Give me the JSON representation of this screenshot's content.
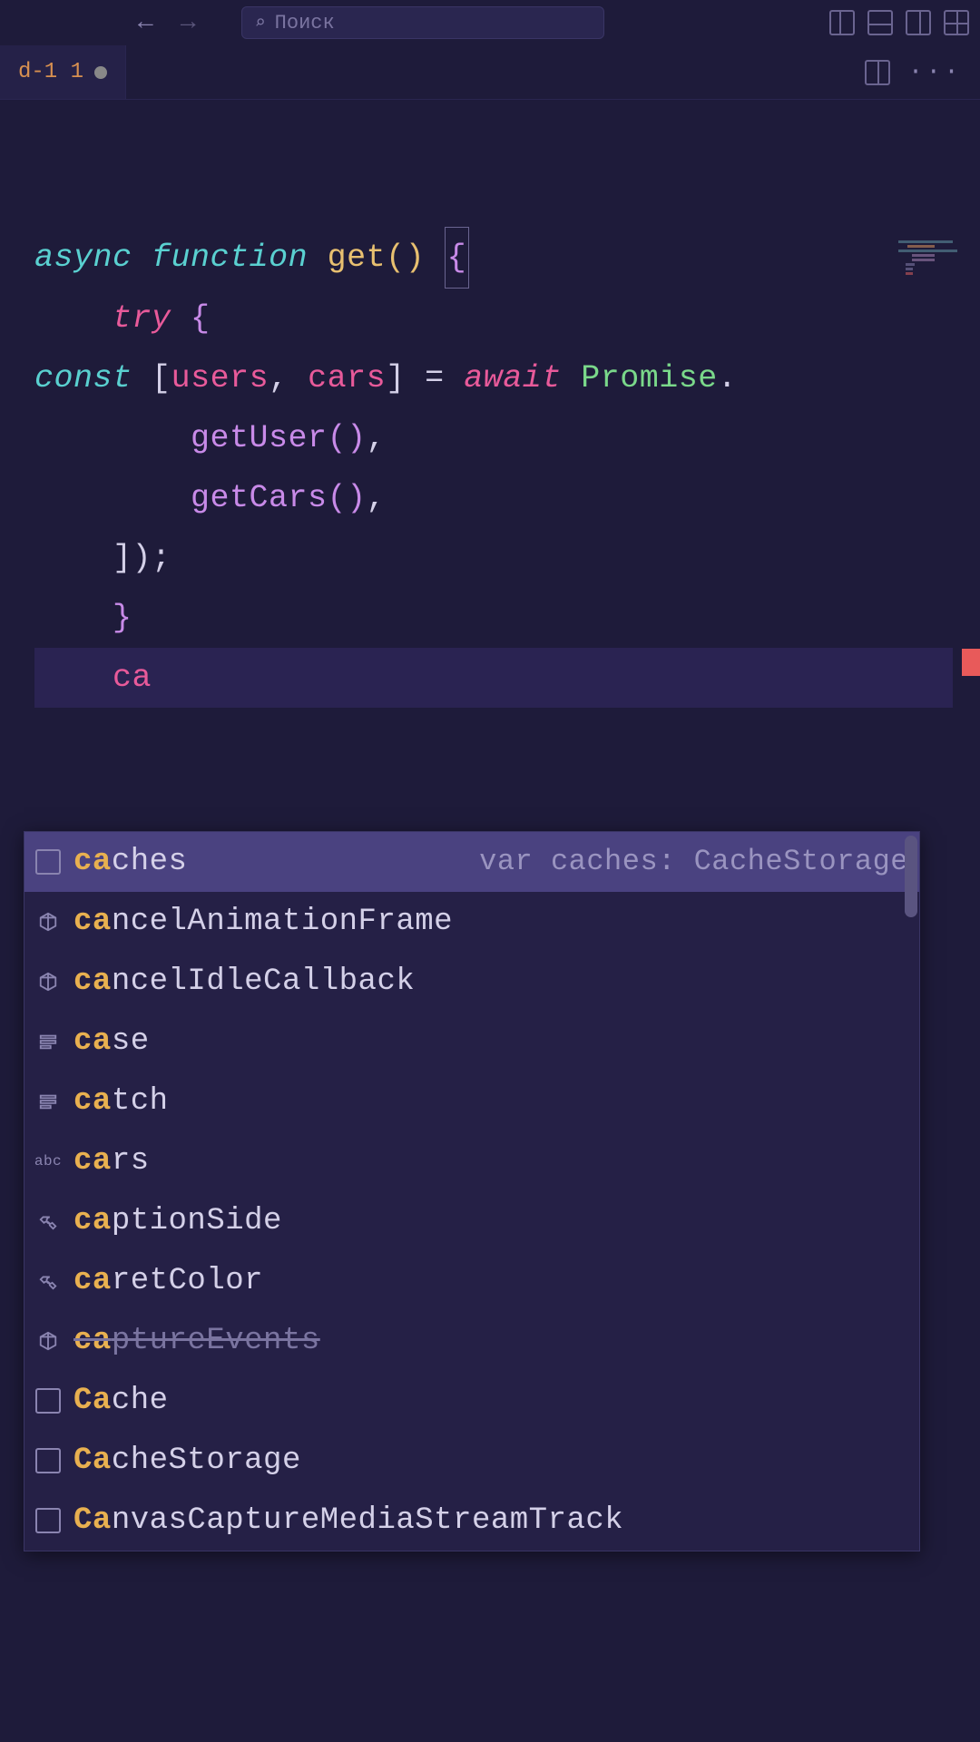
{
  "titlebar": {
    "search_placeholder": "Поиск"
  },
  "tab": {
    "name": "d-1 1"
  },
  "code": {
    "l1_async": "async",
    "l1_function": "function",
    "l1_name": "get",
    "l1_parens": "()",
    "l1_brace": "{",
    "l2_try": "try",
    "l2_brace": "{",
    "l3_const": "const",
    "l3_lbrack": "[",
    "l3_users": "users",
    "l3_comma": ",",
    "l3_cars": "cars",
    "l3_rbrack": "]",
    "l3_eq": "=",
    "l3_await": "await",
    "l3_promise": "Promise",
    "l4_getuser": "getUser",
    "l4_parens": "()",
    "l4_comma": ",",
    "l5_getcars": "getCars",
    "l5_parens": "()",
    "l5_comma": ",",
    "l6_close": "]);",
    "l7_brace": "}",
    "l8_err": "ca"
  },
  "autocomplete": {
    "detail": "var caches: CacheStorage",
    "items": [
      {
        "icon": "namespace",
        "prefix": "ca",
        "rest": "ches",
        "selected": true
      },
      {
        "icon": "cube",
        "prefix": "ca",
        "rest": "ncelAnimationFrame"
      },
      {
        "icon": "cube",
        "prefix": "ca",
        "rest": "ncelIdleCallback"
      },
      {
        "icon": "keyword",
        "prefix": "ca",
        "rest": "se"
      },
      {
        "icon": "keyword",
        "prefix": "ca",
        "rest": "tch"
      },
      {
        "icon": "abc",
        "prefix": "ca",
        "rest": "rs"
      },
      {
        "icon": "wrench",
        "prefix": "ca",
        "rest": "ptionSide"
      },
      {
        "icon": "wrench",
        "prefix": "ca",
        "rest": "retColor"
      },
      {
        "icon": "cube",
        "prefix": "ca",
        "rest": "ptureEvents",
        "deprecated": true
      },
      {
        "icon": "namespace",
        "prefix": "Ca",
        "rest": "che"
      },
      {
        "icon": "namespace",
        "prefix": "Ca",
        "rest": "cheStorage"
      },
      {
        "icon": "namespace",
        "prefix": "Ca",
        "rest": "nvasCaptureMediaStreamTrack"
      }
    ]
  }
}
